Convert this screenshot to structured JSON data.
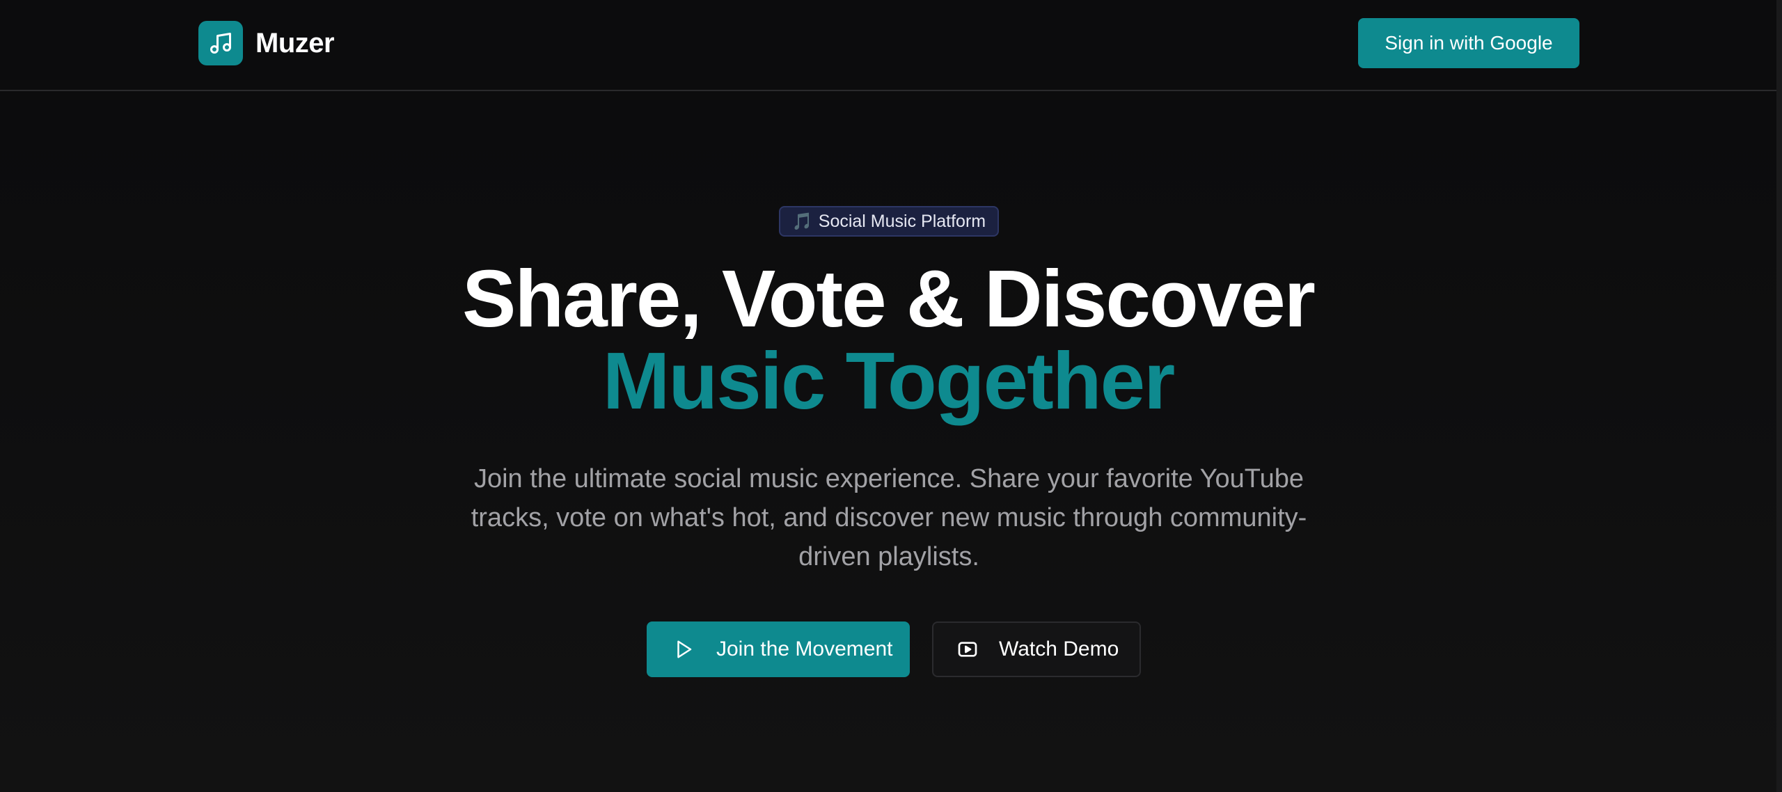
{
  "app": {
    "name": "Muzer",
    "logo_icon": "music-note-icon"
  },
  "header": {
    "signin_label": "Sign in with Google"
  },
  "hero": {
    "badge_icon": "🎵",
    "badge_label": "Social Music Platform",
    "title_line_1": "Share, Vote & Discover",
    "title_line_2": "Music Together",
    "subtitle": "Join the ultimate social music experience. Share your favorite YouTube tracks, vote on what's hot, and discover new music through community-driven playlists.",
    "primary_cta": {
      "label": "Join the Movement",
      "icon": "play-icon"
    },
    "secondary_cta": {
      "label": "Watch Demo",
      "icon": "video-icon"
    }
  },
  "colors": {
    "accent": "#0e8a8f",
    "background": "#0b0b0c",
    "badge_bg": "#1b2140",
    "muted_text": "#a2a2a6"
  }
}
